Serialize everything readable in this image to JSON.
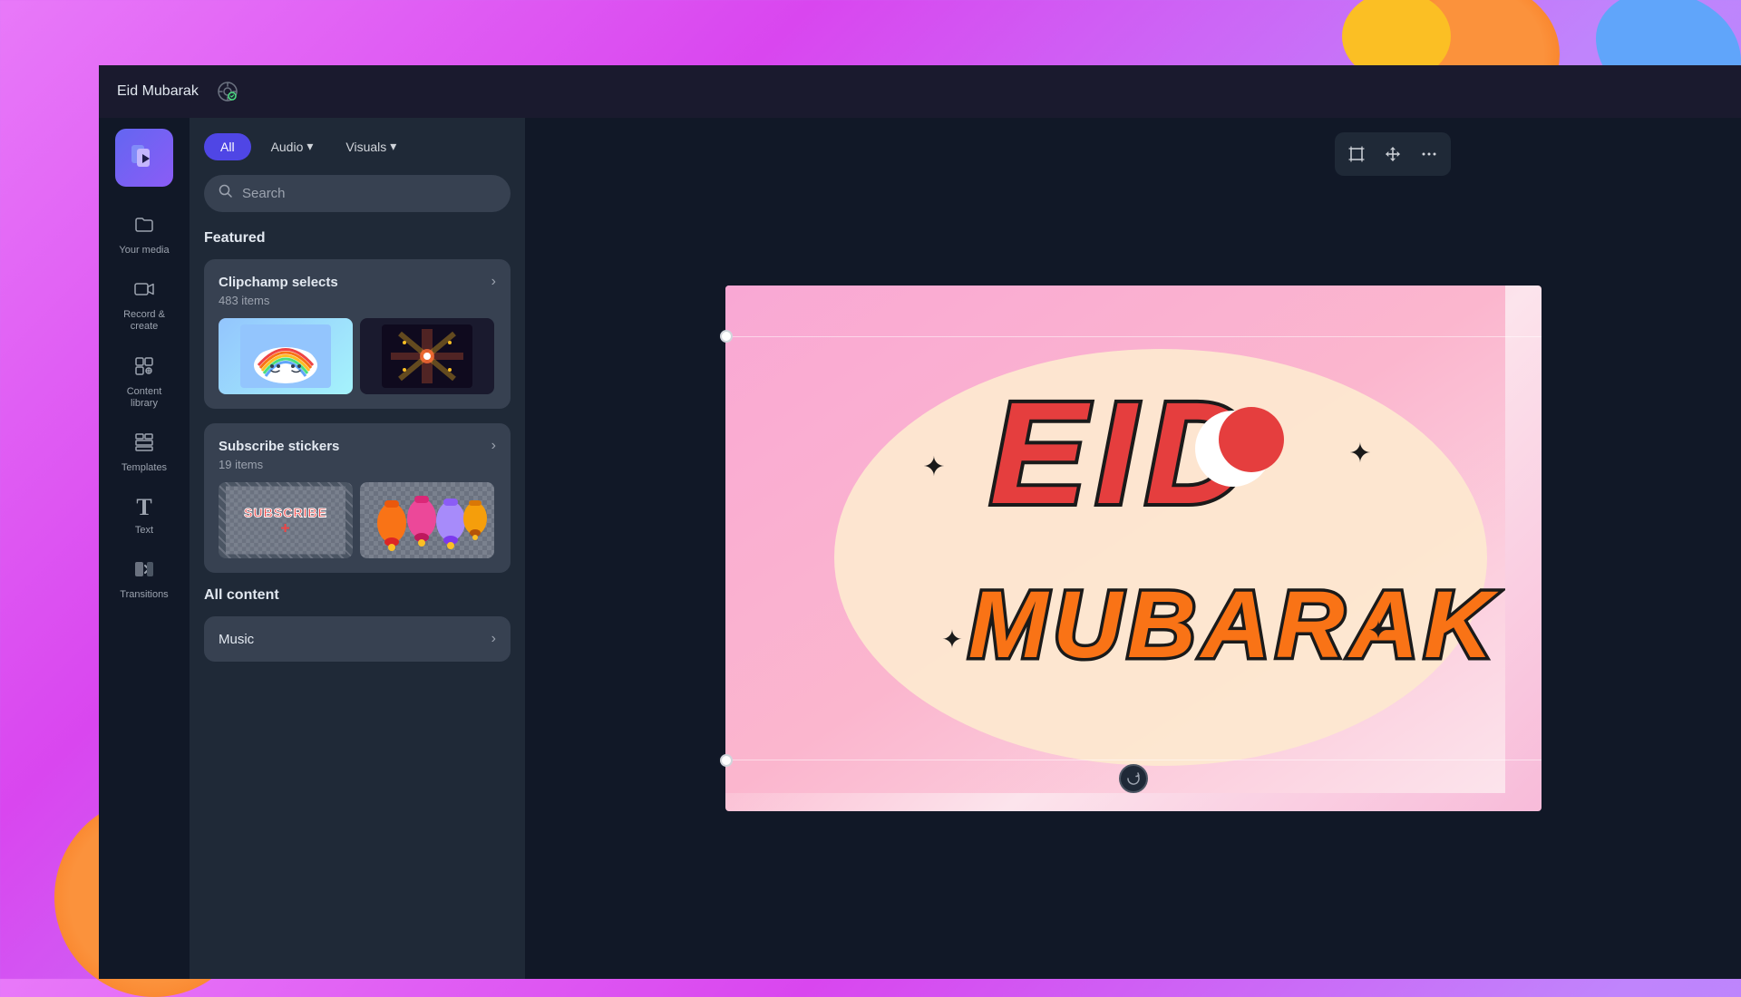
{
  "app": {
    "logo_alt": "Clipchamp logo"
  },
  "topbar": {
    "project_title": "Eid Mubarak",
    "save_icon": "🔔"
  },
  "sidebar": {
    "items": [
      {
        "id": "your-media",
        "label": "Your media",
        "icon": "📁"
      },
      {
        "id": "record-create",
        "label": "Record &\ncreate",
        "icon": "🎥"
      },
      {
        "id": "content-library",
        "label": "Content\nlibrary",
        "icon": "🎭"
      },
      {
        "id": "templates",
        "label": "Templates",
        "icon": "⊞"
      },
      {
        "id": "text",
        "label": "Text",
        "icon": "T"
      },
      {
        "id": "transitions",
        "label": "Transitions",
        "icon": "▶"
      }
    ]
  },
  "filter_tabs": {
    "all_label": "All",
    "audio_label": "Audio",
    "audio_arrow": "▾",
    "visuals_label": "Visuals",
    "visuals_arrow": "▾"
  },
  "search": {
    "placeholder": "Search"
  },
  "featured": {
    "section_title": "Featured",
    "cards": [
      {
        "id": "clipchamp-selects",
        "title": "Clipchamp selects",
        "subtitle": "483 items",
        "arrow": "›",
        "thumb1_emoji": "🌈",
        "thumb1_bg": "rainbow",
        "thumb2_emoji": "✨",
        "thumb2_bg": "sparkle"
      },
      {
        "id": "subscribe-stickers",
        "title": "Subscribe stickers",
        "subtitle": "19 items",
        "arrow": "›",
        "thumb1_text": "SUBSCRIBE+",
        "thumb1_bg": "subscribe",
        "thumb2_emoji": "🔔",
        "thumb2_bg": "bells"
      }
    ]
  },
  "all_content": {
    "section_title": "All content",
    "rows": [
      {
        "id": "music",
        "title": "Music",
        "arrow": "›"
      }
    ]
  },
  "canvas": {
    "eid_text_top": "EID",
    "eid_text_bottom": "MUBARAK",
    "moon_emoji": "☽",
    "star_emoji": "✦"
  },
  "canvas_toolbar": {
    "crop_icon": "⊡",
    "resize_icon": "⟺",
    "more_icon": "···"
  }
}
